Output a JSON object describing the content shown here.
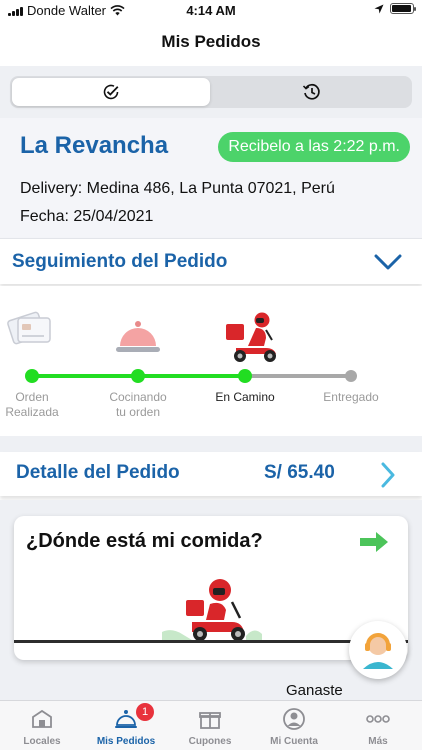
{
  "status_bar": {
    "carrier": "Donde Walter",
    "time": "4:14 AM",
    "battery_level": 0.95
  },
  "nav": {
    "title": "Mis Pedidos"
  },
  "segments": [
    {
      "icon": "check-circle-icon",
      "selected": true
    },
    {
      "icon": "history-clock-icon",
      "selected": false
    }
  ],
  "order": {
    "store": "La Revancha",
    "eta": "Recibelo a las 2:22 p.m.",
    "delivery": "Delivery: Medina 486, La Punta 07021, Perú",
    "date": "Fecha: 25/04/2021"
  },
  "tracking": {
    "title": "Seguimiento del Pedido",
    "steps": [
      {
        "line1": "Orden",
        "line2": "Realizada",
        "done": true,
        "icon": "credit-card-icon"
      },
      {
        "line1": "Cocinando",
        "line2": "tu orden",
        "done": true,
        "icon": "food-cloche-icon"
      },
      {
        "line1": "En Camino",
        "line2": "",
        "done": true,
        "current": true,
        "icon": "delivery-scooter-icon"
      },
      {
        "line1": "Entregado",
        "line2": "",
        "done": false,
        "icon": ""
      }
    ],
    "colors": {
      "done": "#22dd22",
      "pending": "#a8a8a8"
    }
  },
  "detail": {
    "label": "Detalle del Pedido",
    "price": "S/ 65.40"
  },
  "promo": {
    "question": "¿Dónde está mi comida?"
  },
  "ganaste": "Ganaste",
  "tabs": [
    {
      "label": "Locales",
      "icon": "store-icon",
      "active": false
    },
    {
      "label": "Mis Pedidos",
      "icon": "delivery-bell-icon",
      "active": true,
      "badge": "1"
    },
    {
      "label": "Cupones",
      "icon": "gift-icon",
      "active": false
    },
    {
      "label": "Mi Cuenta",
      "icon": "user-icon",
      "active": false
    },
    {
      "label": "Más",
      "icon": "more-icon",
      "active": false
    }
  ],
  "accent": "#1b63a8",
  "eta_color": "#4cd36a"
}
